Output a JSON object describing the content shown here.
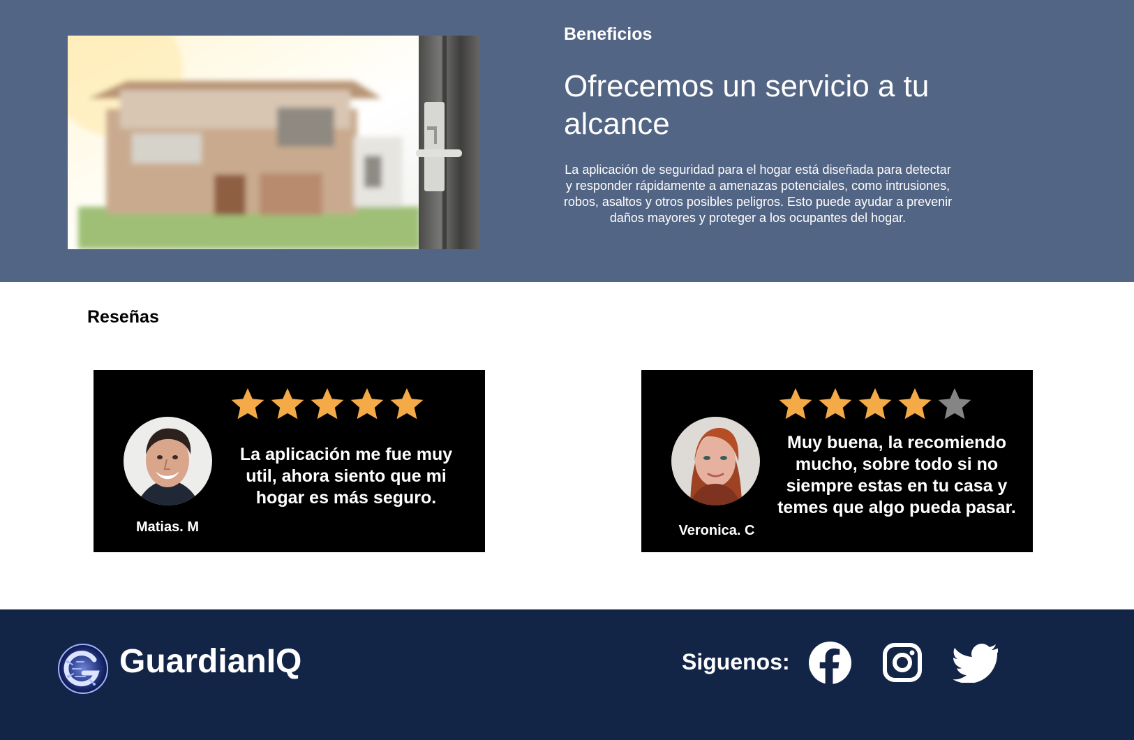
{
  "benefits": {
    "eyebrow": "Beneficios",
    "headline": "Ofrecemos un servicio a tu alcance",
    "description": "La aplicación de seguridad para el hogar está diseñada para detectar y responder rápidamente a amenazas potenciales, como intrusiones, robos, asaltos y otros posibles peligros. Esto puede ayudar a prevenir daños mayores y proteger a los ocupantes del hogar.",
    "image_icon": "house-front-door-photo"
  },
  "reviews": {
    "title": "Reseñas",
    "items": [
      {
        "name": "Matias. M",
        "rating": 5,
        "max_rating": 5,
        "text": "La aplicación me fue muy util, ahora siento que mi hogar es más seguro."
      },
      {
        "name": "Veronica. C",
        "rating": 4,
        "max_rating": 5,
        "text": "Muy buena, la recomiendo mucho, sobre todo si no siempre estas en tu casa y temes que algo pueda pasar."
      }
    ]
  },
  "footer": {
    "brand": "GuardianIQ",
    "follow_label": "Siguenos:",
    "social_icons": [
      "facebook-icon",
      "instagram-icon",
      "twitter-icon"
    ]
  },
  "colors": {
    "hero_background": "#536584",
    "footer_background": "#132546",
    "star_filled": "#F4AA47",
    "star_empty": "#858585"
  }
}
